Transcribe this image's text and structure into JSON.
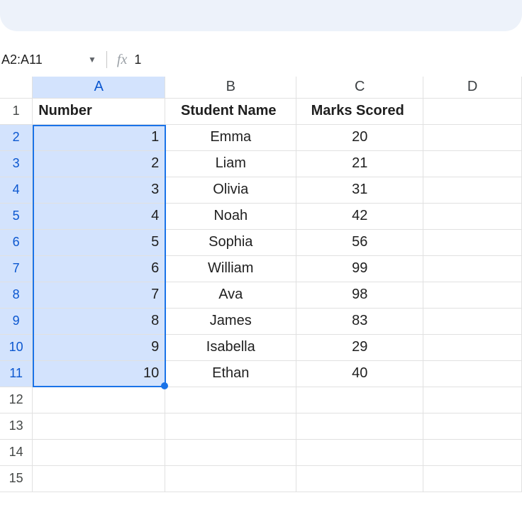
{
  "name_box": "A2:A11",
  "formula_value": "1",
  "columns": [
    "A",
    "B",
    "C",
    "D"
  ],
  "selected_column": "A",
  "row_headers": [
    "1",
    "2",
    "3",
    "4",
    "5",
    "6",
    "7",
    "8",
    "9",
    "10",
    "11",
    "12",
    "13",
    "14",
    "15"
  ],
  "selected_rows": [
    "2",
    "3",
    "4",
    "5",
    "6",
    "7",
    "8",
    "9",
    "10",
    "11"
  ],
  "table_headers": {
    "A": "Number",
    "B": "Student Name",
    "C": "Marks Scored"
  },
  "rows": [
    {
      "number": "1",
      "name": "Emma",
      "marks": "20"
    },
    {
      "number": "2",
      "name": "Liam",
      "marks": "21"
    },
    {
      "number": "3",
      "name": "Olivia",
      "marks": "31"
    },
    {
      "number": "4",
      "name": "Noah",
      "marks": "42"
    },
    {
      "number": "5",
      "name": "Sophia",
      "marks": "56"
    },
    {
      "number": "6",
      "name": "William",
      "marks": "99"
    },
    {
      "number": "7",
      "name": "Ava",
      "marks": "98"
    },
    {
      "number": "8",
      "name": "James",
      "marks": "83"
    },
    {
      "number": "9",
      "name": "Isabella",
      "marks": "29"
    },
    {
      "number": "10",
      "name": "Ethan",
      "marks": "40"
    }
  ]
}
